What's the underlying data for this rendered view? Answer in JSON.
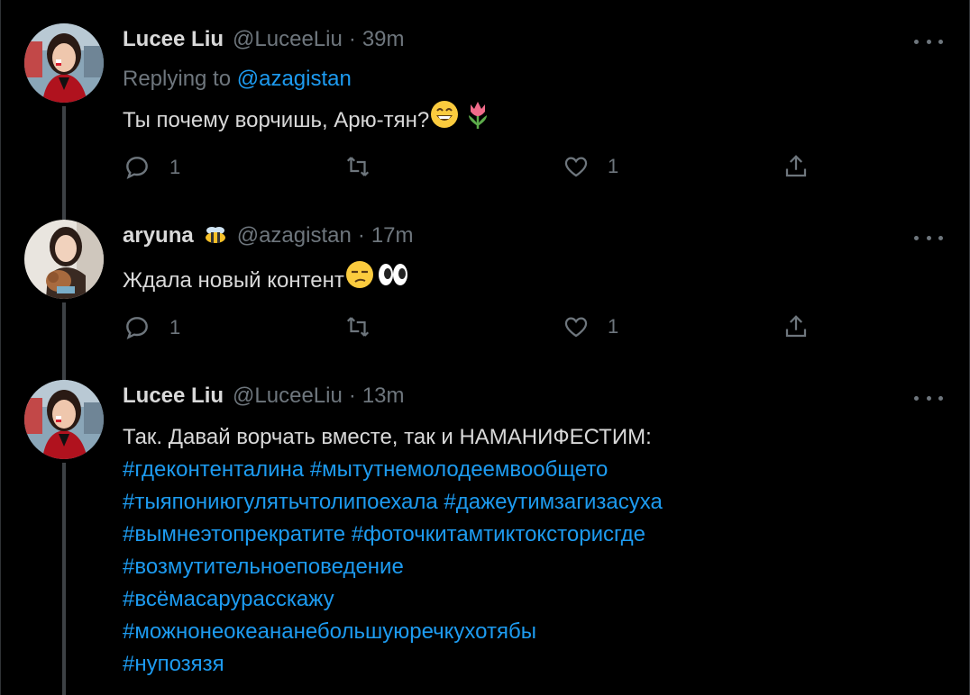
{
  "tweets": [
    {
      "name": "Lucee Liu",
      "handle": "@LuceeLiu",
      "separator": "·",
      "time": "39m",
      "replying_label": "Replying to",
      "replying_mention": "@azagistan",
      "text": "Ты почему ворчишь, Арю-тян?",
      "emojis": [
        "grinning-face-emoji",
        "tulip-emoji"
      ],
      "actions": {
        "reply_count": "1",
        "retweet_count": "",
        "like_count": "1"
      }
    },
    {
      "name": "aryuna",
      "name_emoji": "bee-emoji",
      "handle": "@azagistan",
      "separator": "·",
      "time": "17m",
      "text": "Ждала новый контент",
      "emojis": [
        "unamused-face-emoji",
        "eyes-emoji"
      ],
      "actions": {
        "reply_count": "1",
        "retweet_count": "",
        "like_count": "1"
      }
    },
    {
      "name": "Lucee Liu",
      "handle": "@LuceeLiu",
      "separator": "·",
      "time": "13m",
      "text": "Так. Давай ворчать вместе, так и НАМАНИФЕСТИМ:",
      "hashtag_lines": [
        "#гдеконтенталина #мытутнемолодеемвообщето",
        "#тыяпониюгулятьчтолипоехала #дажеутимзагизасуха",
        "#вымнеэтопрекратите #фоточкитамтиктокysторисгде",
        "#возмутительноеповедение",
        "#всёмасарурасскажу",
        "#можнонеокеананебольшуюречкухотябы",
        "#нупозязя"
      ]
    }
  ],
  "colors": {
    "background": "#000000",
    "text": "#d9d9d9",
    "muted": "#6e767d",
    "accent": "#1d9bf0",
    "thread_line": "#3d4145"
  }
}
